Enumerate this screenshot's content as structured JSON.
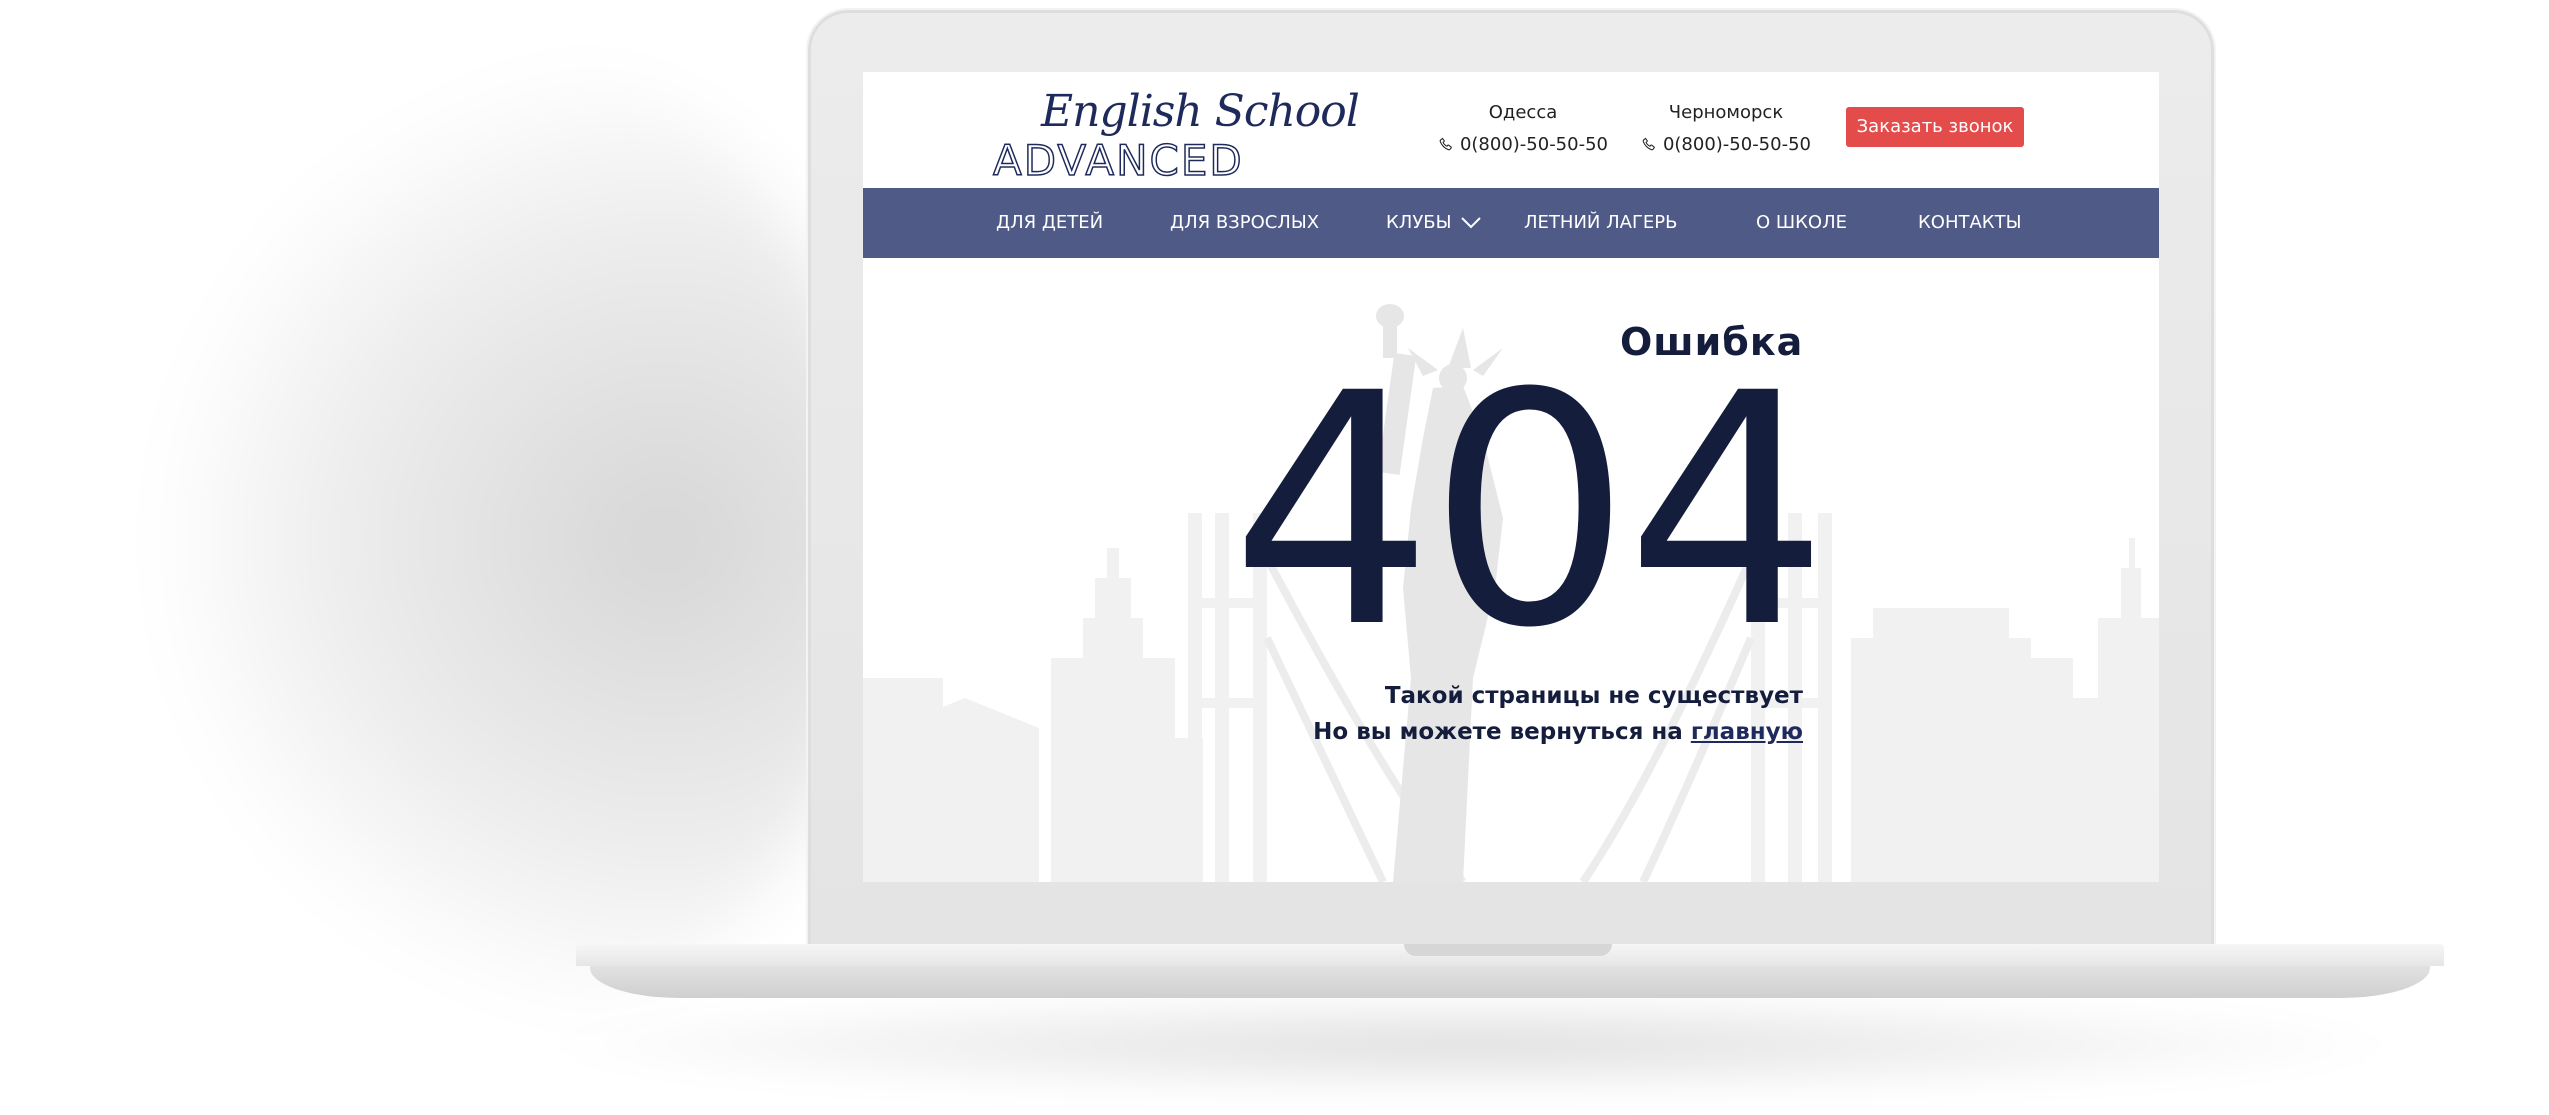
{
  "header": {
    "logo_script": "English School",
    "logo_caps": "ADVANCED",
    "cities": [
      {
        "name": "Одесса",
        "phone": "0(800)-50-50-50"
      },
      {
        "name": "Черноморск",
        "phone": "0(800)-50-50-50"
      }
    ],
    "callback_label": "Заказать звонок"
  },
  "nav": {
    "items": [
      {
        "label": "ДЛЯ ДЕТЕЙ"
      },
      {
        "label": "ДЛЯ ВЗРОСЛЫХ"
      },
      {
        "label": "КЛУБЫ"
      },
      {
        "label": "ЛЕТНИЙ ЛАГЕРЬ"
      },
      {
        "label": "О ШКОЛЕ"
      },
      {
        "label": "КОНТАКТЫ"
      }
    ]
  },
  "error": {
    "title": "Ошибка",
    "code": "404",
    "message_line1": "Такой страницы не существует",
    "message_line2_prefix": "Но вы можете вернуться на",
    "home_link": "главную"
  },
  "colors": {
    "nav_bg": "#505a87",
    "brand_navy": "#1f2a5c",
    "heading_navy": "#151d3d",
    "button_red": "#e44b4b",
    "skyline_gray": "#f0f0f0"
  },
  "icons": {
    "phone": "phone-icon",
    "dropdown": "chevron-down-icon"
  }
}
